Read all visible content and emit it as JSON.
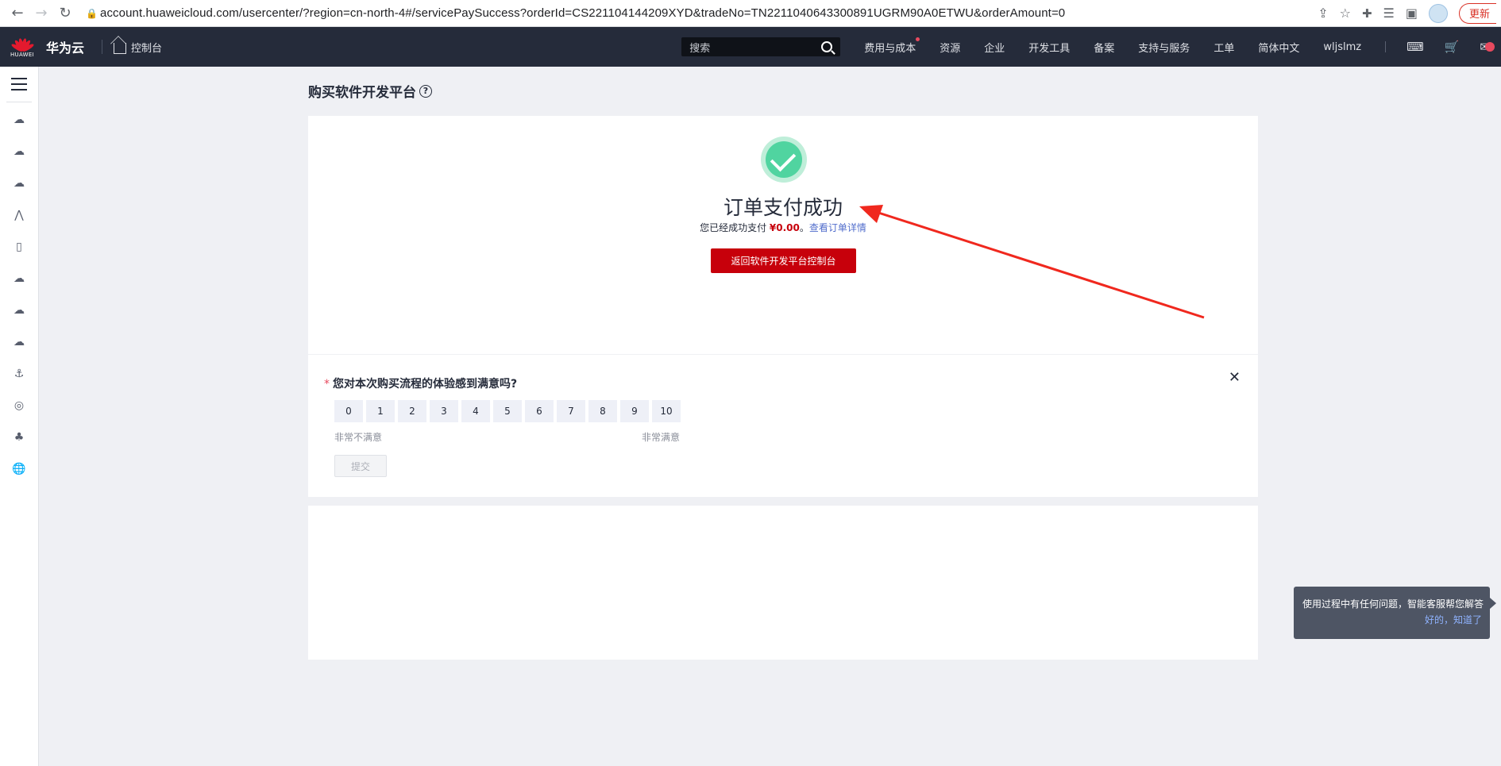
{
  "browser": {
    "url": "account.huaweicloud.com/usercenter/?region=cn-north-4#/servicePaySuccess?orderId=CS221104144209XYD&tradeNo=TN2211040643300891UGRM90A0ETWU&orderAmount=0",
    "update_label": "更新"
  },
  "header": {
    "logo_text": "HUAWEI",
    "brand": "华为云",
    "console_label": "控制台",
    "search_placeholder": "搜索",
    "nav": [
      "费用与成本",
      "资源",
      "企业",
      "开发工具",
      "备案",
      "支持与服务",
      "工单",
      "简体中文",
      "wljslmz"
    ]
  },
  "page": {
    "title": "购买软件开发平台",
    "help_glyph": "?"
  },
  "success": {
    "title": "订单支付成功",
    "sub_prefix": "您已经成功支付 ",
    "amount": "¥0.00",
    "sub_sep": "。",
    "details_link": "查看订单详情",
    "back_button": "返回软件开发平台控制台"
  },
  "survey": {
    "required_mark": "*",
    "question": "您对本次购买流程的体验感到满意吗?",
    "scores": [
      "0",
      "1",
      "2",
      "3",
      "4",
      "5",
      "6",
      "7",
      "8",
      "9",
      "10"
    ],
    "low_label": "非常不满意",
    "high_label": "非常满意",
    "submit_label": "提交"
  },
  "tooltip": {
    "text": "使用过程中有任何问题，智能客服帮您解答",
    "action": "好的，知道了"
  },
  "colors": {
    "header_bg": "#252b3a",
    "primary_red": "#c7000b",
    "success_green": "#50d4a0",
    "link_blue": "#526ecc",
    "annotation_arrow": "#f0281e"
  }
}
